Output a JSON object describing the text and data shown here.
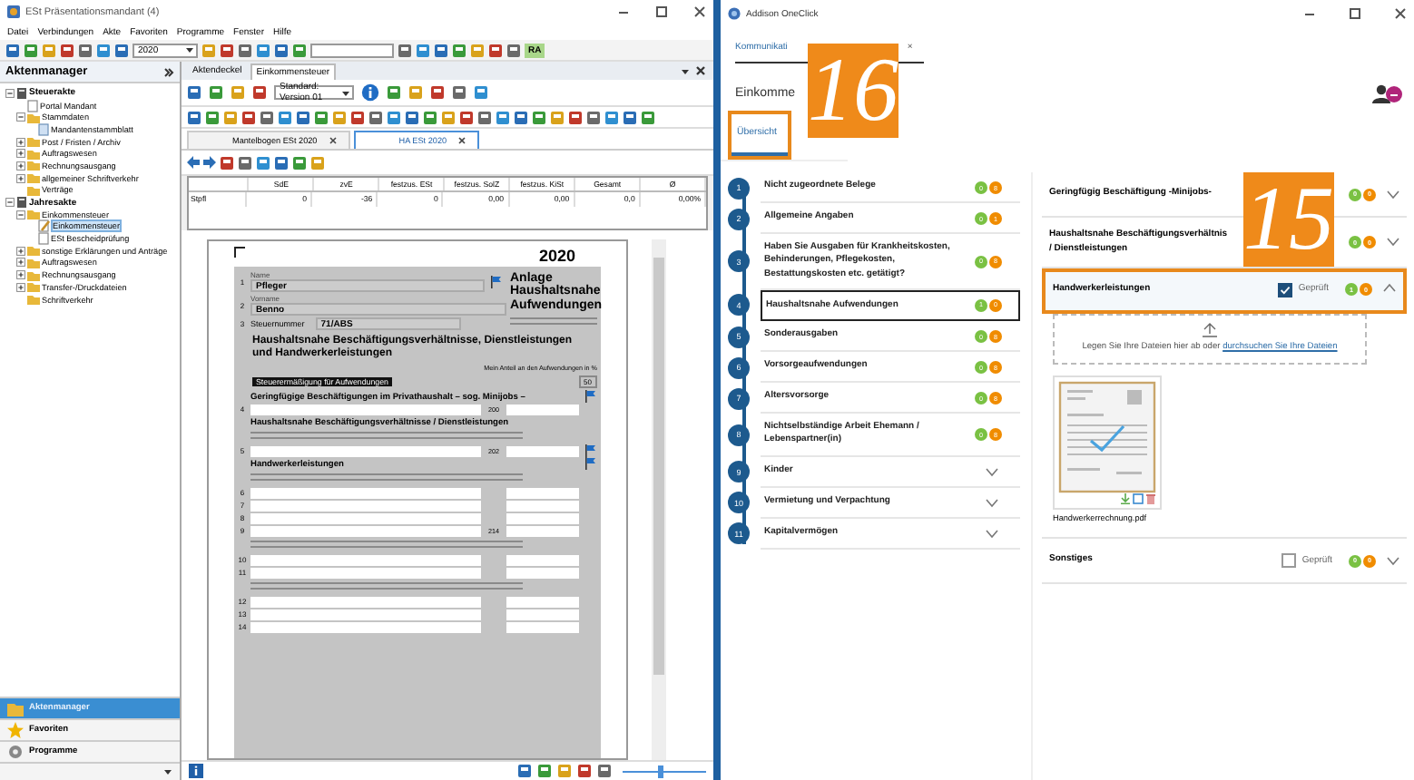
{
  "left_window": {
    "title": "ESt Präsentationsmandant (4)",
    "menu": [
      "Datei",
      "Verbindungen",
      "Akte",
      "Favoriten",
      "Programme",
      "Fenster",
      "Hilfe"
    ],
    "year": "2020",
    "user_badge": "RA",
    "sidebar": {
      "title": "Aktenmanager",
      "tree": [
        {
          "label": "Steuerakte",
          "kind": "root",
          "expanded": true,
          "selected": false,
          "children": [
            {
              "label": "Portal Mandant",
              "kind": "document",
              "selected": false
            },
            {
              "label": "Stammdaten",
              "kind": "folder",
              "expanded": true,
              "selected": false,
              "children": [
                {
                  "label": "Mandantenstammblatt",
                  "kind": "sheet",
                  "selected": false
                }
              ]
            },
            {
              "label": "Post / Fristen / Archiv",
              "kind": "folder",
              "expanded": false,
              "selected": false
            },
            {
              "label": "Auftragswesen",
              "kind": "folder",
              "expanded": false,
              "selected": false
            },
            {
              "label": "Rechnungsausgang",
              "kind": "folder",
              "expanded": false,
              "selected": false
            },
            {
              "label": "allgemeiner Schriftverkehr",
              "kind": "folder",
              "expanded": false,
              "selected": false
            },
            {
              "label": "Verträge",
              "kind": "folder",
              "selected": false
            }
          ]
        },
        {
          "label": "Jahresakte",
          "kind": "root",
          "expanded": true,
          "selected": false,
          "children": [
            {
              "label": "Einkommensteuer",
              "kind": "folder",
              "expanded": true,
              "selected": false,
              "children": [
                {
                  "label": "Einkommensteuer",
                  "kind": "edit",
                  "selected": true
                },
                {
                  "label": "ESt Bescheidprüfung",
                  "kind": "document",
                  "selected": false
                }
              ]
            },
            {
              "label": "sonstige Erklärungen und Anträge",
              "kind": "folder",
              "expanded": false,
              "selected": false
            },
            {
              "label": "Auftragswesen",
              "kind": "folder",
              "expanded": false,
              "selected": false
            },
            {
              "label": "Rechnungsausgang",
              "kind": "folder",
              "expanded": false,
              "selected": false
            },
            {
              "label": "Transfer-/Druckdateien",
              "kind": "folder",
              "expanded": false,
              "selected": false
            },
            {
              "label": "Schriftverkehr",
              "kind": "folder",
              "selected": false
            }
          ]
        }
      ],
      "nav": [
        {
          "label": "Aktenmanager",
          "kind": "folder",
          "selected": true
        },
        {
          "label": "Favoriten",
          "kind": "star",
          "selected": false
        },
        {
          "label": "Programme",
          "kind": "gear",
          "selected": false
        }
      ]
    },
    "doc_tabs": [
      {
        "label": "Aktendeckel",
        "selected": false
      },
      {
        "label": "Einkommensteuer",
        "selected": true
      }
    ],
    "version": "Standard: Version 01",
    "form_tabs": [
      {
        "label": "Mantelbogen ESt 2020",
        "selected": false
      },
      {
        "label": "HA ESt 2020",
        "selected": true
      }
    ],
    "table": {
      "columns": [
        "SdE",
        "zvE",
        "festzus. ESt",
        "festzus. SolZ",
        "festzus. KiSt",
        "Gesamt",
        "Ø"
      ],
      "rows": [
        {
          "label": "Stpfl",
          "cells": [
            "0",
            "-36",
            "0",
            "0,00",
            "0,00",
            "0,0",
            "0,00%"
          ]
        }
      ]
    },
    "form": {
      "year": "2020",
      "title": "Anlage Haushaltsnahe Aufwendungen",
      "heading": "Haushaltsnahe Beschäftigungsverhältnisse, Dienstleistungen und Handwerkerleistungen",
      "share_label": "Mein Anteil an den Aufwendungen in %",
      "section": "Steuerermäßigung für Aufwendungen",
      "section_code": "50",
      "rows": [
        {
          "kind": "field",
          "line": "1",
          "caption": "Name",
          "value": "Pfleger",
          "flag": true
        },
        {
          "kind": "field",
          "line": "2",
          "caption": "Vorname",
          "value": "Benno",
          "flag": false
        },
        {
          "kind": "field",
          "line": "3",
          "caption": "Steuernummer",
          "value": "71/ABS",
          "flag": false
        },
        {
          "kind": "heading",
          "text": "Geringfügige Beschäftigungen im Privathaushalt – sog. Minijobs –",
          "flag": true
        },
        {
          "kind": "input",
          "line": "4",
          "code": "200",
          "flag": false
        },
        {
          "kind": "heading",
          "text": "Haushaltsnahe Beschäftigungsverhältnisse / Dienstleistungen",
          "flag": false
        },
        {
          "kind": "note",
          "flag": false
        },
        {
          "kind": "input",
          "line": "5",
          "code": "202",
          "flag": true
        },
        {
          "kind": "heading",
          "text": "Handwerkerleistungen",
          "flag": true
        },
        {
          "kind": "note",
          "flag": false
        },
        {
          "kind": "input",
          "line": "6",
          "flag": false
        },
        {
          "kind": "input",
          "line": "7",
          "flag": false
        },
        {
          "kind": "input",
          "line": "8",
          "flag": false
        },
        {
          "kind": "input",
          "line": "9",
          "code": "214",
          "flag": false
        },
        {
          "kind": "note",
          "flag": false
        },
        {
          "kind": "input",
          "line": "10",
          "flag": false
        },
        {
          "kind": "input",
          "line": "11",
          "flag": false
        },
        {
          "kind": "note",
          "flag": false
        },
        {
          "kind": "input",
          "line": "12",
          "flag": false
        },
        {
          "kind": "input",
          "line": "13",
          "flag": false
        },
        {
          "kind": "input",
          "line": "14",
          "flag": false
        }
      ]
    },
    "zoom": {
      "level": 0.45
    }
  },
  "right_window": {
    "title": "Addison OneClick",
    "tab": "Kommunikati",
    "tab_close": "×",
    "heading": "Einkomme",
    "view_tab": {
      "label": "Übersicht",
      "selected": true,
      "highlighted": true
    },
    "steps": [
      {
        "number": "1",
        "label": "Nicht zugeordnete Belege",
        "kind": "counts",
        "ok": "0",
        "open": "8",
        "selected": false
      },
      {
        "number": "2",
        "label": "Allgemeine Angaben",
        "kind": "counts",
        "ok": "0",
        "open": "1",
        "selected": false
      },
      {
        "number": "3",
        "label": "Haben Sie Ausgaben für Krankheitskosten, Behinderungen, Pflegekosten, Bestattungskosten etc. getätigt?",
        "kind": "counts",
        "ok": "0",
        "open": "8",
        "selected": false
      },
      {
        "number": "4",
        "label": "Haushaltsnahe Aufwendungen",
        "kind": "counts",
        "ok": "1",
        "open": "0",
        "selected": true
      },
      {
        "number": "5",
        "label": "Sonderausgaben",
        "kind": "counts",
        "ok": "0",
        "open": "8",
        "selected": false
      },
      {
        "number": "6",
        "label": "Vorsorgeaufwendungen",
        "kind": "counts",
        "ok": "0",
        "open": "8",
        "selected": false
      },
      {
        "number": "7",
        "label": "Altersvorsorge",
        "kind": "counts",
        "ok": "0",
        "open": "8",
        "selected": false
      },
      {
        "number": "8",
        "label": "Nichtselbständige Arbeit Ehemann / Lebenspartner(in)",
        "kind": "counts",
        "ok": "0",
        "open": "8",
        "selected": false
      },
      {
        "number": "9",
        "label": "Kinder",
        "kind": "collapsible",
        "selected": false
      },
      {
        "number": "10",
        "label": "Vermietung und Verpachtung",
        "kind": "collapsible",
        "selected": false
      },
      {
        "number": "11",
        "label": "Kapitalvermögen",
        "kind": "collapsible",
        "selected": false
      }
    ],
    "sections": [
      {
        "title": "Geringfügig Beschäftigung -Minijobs-",
        "ok": "0",
        "open": "0",
        "expanded": false,
        "highlighted": false
      },
      {
        "title": "Haushaltsnahe Beschäftigungsverhältnis\n/ Dienstleistungen",
        "ok": "0",
        "open": "0",
        "expanded": false,
        "highlighted": false
      },
      {
        "title": "Handwerkerleistungen",
        "check_label": "Geprüft",
        "checked": true,
        "ok": "1",
        "open": "0",
        "expanded": true,
        "highlighted": true,
        "dropzone": {
          "text": "Legen Sie Ihre Dateien hier ab oder ",
          "link": "durchsuchen Sie Ihre Dateien"
        },
        "files": [
          {
            "name": "Handwerkerrechnung.pdf"
          }
        ]
      },
      {
        "title": "Sonstiges",
        "check_label": "Geprüft",
        "checked": false,
        "ok": "0",
        "open": "0",
        "expanded": false,
        "highlighted": false
      }
    ]
  },
  "callouts": [
    {
      "number": "16"
    },
    {
      "number": "15"
    }
  ]
}
